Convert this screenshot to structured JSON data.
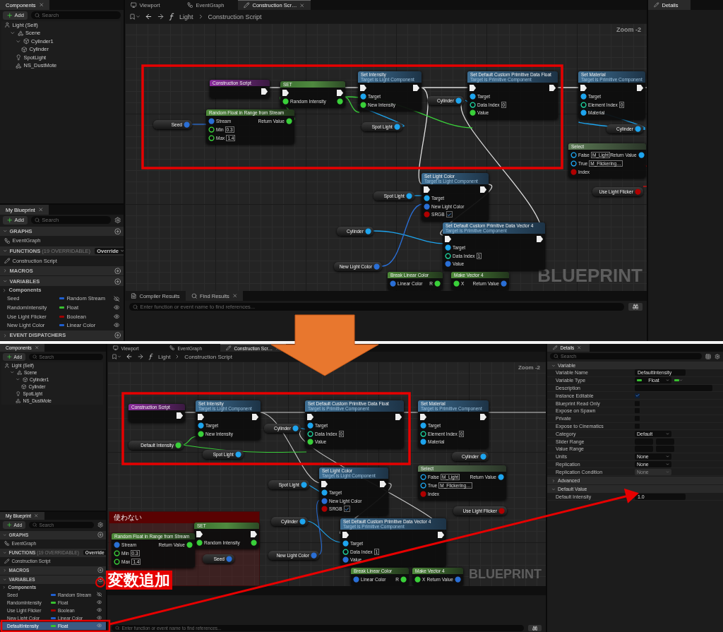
{
  "screens": [
    {
      "components": {
        "tab": "Components",
        "add": "Add",
        "search_placeholder": "Search",
        "tree": [
          {
            "label": "Light (Self)",
            "kind": "actor",
            "children": [
              {
                "label": "Scene",
                "kind": "scene",
                "expanded": true,
                "children": [
                  {
                    "label": "Cylinder1",
                    "kind": "mesh",
                    "expanded": true,
                    "children": [
                      {
                        "label": "Cylinder",
                        "kind": "mesh"
                      }
                    ]
                  },
                  {
                    "label": "SpotLight",
                    "kind": "light"
                  },
                  {
                    "label": "NS_DustMote",
                    "kind": "scene"
                  }
                ]
              }
            ]
          }
        ]
      },
      "my_blueprint": {
        "tab": "My Blueprint",
        "add": "Add",
        "search_placeholder": "Search",
        "sections": [
          {
            "title": "GRAPHS",
            "expanded": true,
            "items": [
              {
                "label": "EventGraph",
                "kind": "graph"
              }
            ]
          },
          {
            "title": "FUNCTIONS",
            "note": "(19 OVERRIDABLE)",
            "action": "Override",
            "expanded": true,
            "items": [
              {
                "label": "Construction Script",
                "kind": "function"
              }
            ]
          },
          {
            "title": "MACROS",
            "expanded": false
          },
          {
            "title": "VARIABLES",
            "expanded": true,
            "items": [
              {
                "label": "Components",
                "kind": "category"
              },
              {
                "label": "Seed",
                "kind": "variable",
                "type": "Random Stream",
                "color": "#1f5fd0",
                "visible": false,
                "selected": false
              },
              {
                "label": "RandomIntensity",
                "kind": "variable",
                "type": "Float",
                "color": "#38c030",
                "visible": true,
                "selected": false
              },
              {
                "label": "Use Light Flicker",
                "kind": "variable",
                "type": "Boolean",
                "color": "#a00000",
                "visible": true,
                "selected": false
              },
              {
                "label": "New Light Color",
                "kind": "variable",
                "type": "Linear Color",
                "color": "#1f5fd0",
                "visible": true,
                "selected": false
              }
            ]
          },
          {
            "title": "EVENT DISPATCHERS",
            "expanded": false
          }
        ]
      },
      "graph_tabs": [
        {
          "label": "Viewport",
          "kind": "viewport",
          "selected": false
        },
        {
          "label": "EventGraph",
          "kind": "graph",
          "selected": false
        },
        {
          "label": "Construction Scr…",
          "kind": "function",
          "selected": true
        }
      ],
      "breadcrumb": [
        "Light",
        "Construction Script"
      ],
      "zoom": "Zoom -2",
      "watermark": "BLUEPRINT",
      "nodes": [
        {
          "kind": "event",
          "title": "Construction Script",
          "outputs": [
            {
              "kind": "exec"
            }
          ]
        },
        {
          "kind": "setter",
          "title": "SET",
          "inputs": [
            {
              "kind": "exec"
            },
            {
              "kind": "float",
              "label": "Random Intensity"
            }
          ],
          "outputs": [
            {
              "kind": "exec"
            },
            {
              "kind": "float"
            }
          ]
        },
        {
          "kind": "variable",
          "title": "Seed",
          "outputs": [
            {
              "kind": "struct"
            }
          ]
        },
        {
          "kind": "pure",
          "title": "Random Float in Range from Stream",
          "inputs": [
            {
              "kind": "struct",
              "label": "Stream"
            },
            {
              "kind": "float",
              "label": "Min",
              "value": "0.3"
            },
            {
              "kind": "float",
              "label": "Max",
              "value": "1.4"
            }
          ],
          "outputs": [
            {
              "kind": "float",
              "label": "Return Value"
            }
          ]
        },
        {
          "kind": "function",
          "title": "Set Intensity",
          "subtitle": "Target is Light Component",
          "inputs": [
            {
              "kind": "exec"
            },
            {
              "kind": "object",
              "label": "Target"
            },
            {
              "kind": "float",
              "label": "New Intensity"
            }
          ],
          "outputs": [
            {
              "kind": "exec"
            }
          ]
        },
        {
          "kind": "variable",
          "title": "Spot Light",
          "outputs": [
            {
              "kind": "object"
            }
          ]
        },
        {
          "kind": "variable",
          "title": "Cylinder",
          "outputs": [
            {
              "kind": "object"
            }
          ]
        },
        {
          "kind": "function",
          "title": "Set Default Custom Primitive Data Float",
          "subtitle": "Target is Primitive Component",
          "inputs": [
            {
              "kind": "exec"
            },
            {
              "kind": "object",
              "label": "Target"
            },
            {
              "kind": "int",
              "label": "Data Index",
              "value": "0"
            },
            {
              "kind": "float",
              "label": "Value"
            }
          ],
          "outputs": [
            {
              "kind": "exec"
            }
          ]
        },
        {
          "kind": "function",
          "title": "Set Material",
          "subtitle": "Target is Primitive Component",
          "inputs": [
            {
              "kind": "exec"
            },
            {
              "kind": "object",
              "label": "Target"
            },
            {
              "kind": "int",
              "label": "Element Index",
              "value": "0"
            },
            {
              "kind": "object",
              "label": "Material"
            }
          ],
          "outputs": [
            {
              "kind": "exec"
            }
          ]
        },
        {
          "kind": "variable",
          "title": "Cylinder",
          "outputs": [
            {
              "kind": "object"
            }
          ]
        },
        {
          "kind": "select",
          "title": "Select",
          "inputs": [
            {
              "kind": "object",
              "label": "False",
              "value": "M_Light"
            },
            {
              "kind": "object",
              "label": "True",
              "value": "M_Flickering…"
            },
            {
              "kind": "bool",
              "label": "Index"
            }
          ],
          "outputs": [
            {
              "kind": "object",
              "label": "Return Value"
            }
          ]
        },
        {
          "kind": "variable",
          "title": "Use Light Flicker",
          "outputs": [
            {
              "kind": "bool"
            }
          ]
        },
        {
          "kind": "variable",
          "title": "Spot Light",
          "outputs": [
            {
              "kind": "object"
            }
          ]
        },
        {
          "kind": "function",
          "title": "Set Light Color",
          "subtitle": "Target is Light Component",
          "inputs": [
            {
              "kind": "exec"
            },
            {
              "kind": "object",
              "label": "Target"
            },
            {
              "kind": "struct",
              "label": "New Light Color"
            },
            {
              "kind": "bool",
              "label": "SRGB",
              "checked": true
            }
          ],
          "outputs": [
            {
              "kind": "exec"
            }
          ]
        },
        {
          "kind": "variable",
          "title": "Cylinder",
          "outputs": [
            {
              "kind": "object"
            }
          ]
        },
        {
          "kind": "function",
          "title": "Set Default Custom Primitive Data Vector 4",
          "subtitle": "Target is Primitive Component",
          "inputs": [
            {
              "kind": "exec"
            },
            {
              "kind": "object",
              "label": "Target"
            },
            {
              "kind": "int",
              "label": "Data Index",
              "value": "1"
            },
            {
              "kind": "struct",
              "label": "Value"
            }
          ],
          "outputs": [
            {
              "kind": "exec"
            }
          ]
        },
        {
          "kind": "variable",
          "title": "New Light Color",
          "outputs": [
            {
              "kind": "struct"
            }
          ]
        },
        {
          "kind": "pure",
          "title": "Break Linear Color",
          "inputs": [
            {
              "kind": "struct",
              "label": "Linear Color"
            }
          ],
          "outputs": [
            {
              "kind": "float",
              "label": "R"
            }
          ]
        },
        {
          "kind": "pure",
          "title": "Make Vector 4",
          "inputs": [
            {
              "kind": "float",
              "label": "X"
            }
          ],
          "outputs": [
            {
              "kind": "struct",
              "label": "Return Value"
            }
          ]
        }
      ],
      "results": {
        "tabs": [
          {
            "label": "Compiler Results",
            "kind": "log",
            "selected": false
          },
          {
            "label": "Find Results",
            "kind": "search",
            "selected": true
          }
        ],
        "placeholder": "Enter function or event name to find references..."
      },
      "details": {
        "tab": "Details"
      }
    },
    {
      "components": {
        "tab": "Components",
        "add": "Add",
        "search_placeholder": "Search",
        "tree": [
          {
            "label": "Light (Self)",
            "kind": "actor",
            "children": [
              {
                "label": "Scene",
                "kind": "scene",
                "expanded": true,
                "children": [
                  {
                    "label": "Cylinder1",
                    "kind": "mesh",
                    "expanded": true,
                    "children": [
                      {
                        "label": "Cylinder",
                        "kind": "mesh"
                      }
                    ]
                  },
                  {
                    "label": "SpotLight",
                    "kind": "light"
                  },
                  {
                    "label": "NS_DustMote",
                    "kind": "scene"
                  }
                ]
              }
            ]
          }
        ]
      },
      "my_blueprint": {
        "tab": "My Blueprint",
        "add": "Add",
        "search_placeholder": "Search",
        "sections": [
          {
            "title": "GRAPHS",
            "expanded": true,
            "items": [
              {
                "label": "EventGraph",
                "kind": "graph"
              }
            ]
          },
          {
            "title": "FUNCTIONS",
            "note": "(19 OVERRIDABLE)",
            "action": "Override",
            "expanded": true,
            "items": [
              {
                "label": "Construction Script",
                "kind": "function"
              }
            ]
          },
          {
            "title": "MACROS",
            "expanded": false
          },
          {
            "title": "VARIABLES",
            "expanded": true,
            "items": [
              {
                "label": "Components",
                "kind": "category"
              },
              {
                "label": "Seed",
                "kind": "variable",
                "type": "Random Stream",
                "color": "#1f5fd0",
                "visible": false,
                "selected": false
              },
              {
                "label": "RandomIntensity",
                "kind": "variable",
                "type": "Float",
                "color": "#38c030",
                "visible": true,
                "selected": false
              },
              {
                "label": "Use Light Flicker",
                "kind": "variable",
                "type": "Boolean",
                "color": "#a00000",
                "visible": true,
                "selected": false
              },
              {
                "label": "New Light Color",
                "kind": "variable",
                "type": "Linear Color",
                "color": "#1f5fd0",
                "visible": true,
                "selected": false
              },
              {
                "label": "DefaultIntensity",
                "kind": "variable",
                "type": "Float",
                "color": "#38c030",
                "visible": true,
                "selected": true
              }
            ]
          }
        ]
      },
      "graph_tabs": [
        {
          "label": "Viewport",
          "kind": "viewport",
          "selected": false
        },
        {
          "label": "EventGraph",
          "kind": "graph",
          "selected": false
        },
        {
          "label": "Construction Scr…",
          "kind": "function",
          "selected": true
        }
      ],
      "breadcrumb": [
        "Light",
        "Construction Script"
      ],
      "zoom": "Zoom -2",
      "watermark": "BLUEPRINT",
      "nodes": [
        {
          "kind": "event",
          "title": "Construction Script",
          "outputs": [
            {
              "kind": "exec"
            }
          ]
        },
        {
          "kind": "function",
          "title": "Set Intensity",
          "subtitle": "Target is Light Component",
          "inputs": [
            {
              "kind": "exec"
            },
            {
              "kind": "object",
              "label": "Target"
            },
            {
              "kind": "float",
              "label": "New Intensity"
            }
          ],
          "outputs": [
            {
              "kind": "exec"
            }
          ]
        },
        {
          "kind": "variable",
          "title": "Default Intensity",
          "outputs": [
            {
              "kind": "float"
            }
          ]
        },
        {
          "kind": "variable",
          "title": "Spot Light",
          "outputs": [
            {
              "kind": "object"
            }
          ]
        },
        {
          "kind": "variable",
          "title": "Cylinder",
          "outputs": [
            {
              "kind": "object"
            }
          ]
        },
        {
          "kind": "function",
          "title": "Set Default Custom Primitive Data Float",
          "subtitle": "Target is Primitive Component",
          "inputs": [
            {
              "kind": "exec"
            },
            {
              "kind": "object",
              "label": "Target"
            },
            {
              "kind": "int",
              "label": "Data Index",
              "value": "0"
            },
            {
              "kind": "float",
              "label": "Value"
            }
          ],
          "outputs": [
            {
              "kind": "exec"
            }
          ]
        },
        {
          "kind": "function",
          "title": "Set Material",
          "subtitle": "Target is Primitive Component",
          "inputs": [
            {
              "kind": "exec"
            },
            {
              "kind": "object",
              "label": "Target"
            },
            {
              "kind": "int",
              "label": "Element Index",
              "value": "0"
            },
            {
              "kind": "object",
              "label": "Material"
            }
          ],
          "outputs": [
            {
              "kind": "exec"
            }
          ]
        },
        {
          "kind": "variable",
          "title": "Cylinder",
          "outputs": [
            {
              "kind": "object"
            }
          ]
        },
        {
          "kind": "select",
          "title": "Select",
          "inputs": [
            {
              "kind": "object",
              "label": "False",
              "value": "M_Light"
            },
            {
              "kind": "object",
              "label": "True",
              "value": "M_Flickering…"
            },
            {
              "kind": "bool",
              "label": "Index"
            }
          ],
          "outputs": [
            {
              "kind": "object",
              "label": "Return Value"
            }
          ]
        },
        {
          "kind": "variable",
          "title": "Use Light Flicker",
          "outputs": [
            {
              "kind": "bool"
            }
          ]
        },
        {
          "kind": "variable",
          "title": "Spot Light",
          "outputs": [
            {
              "kind": "object"
            }
          ]
        },
        {
          "kind": "function",
          "title": "Set Light Color",
          "subtitle": "Target is Light Component",
          "inputs": [
            {
              "kind": "exec"
            },
            {
              "kind": "object",
              "label": "Target"
            },
            {
              "kind": "struct",
              "label": "New Light Color"
            },
            {
              "kind": "bool",
              "label": "SRGB",
              "checked": true
            }
          ],
          "outputs": [
            {
              "kind": "exec"
            }
          ]
        },
        {
          "kind": "variable",
          "title": "Cylinder",
          "outputs": [
            {
              "kind": "object"
            }
          ]
        },
        {
          "kind": "function",
          "title": "Set Default Custom Primitive Data Vector 4",
          "subtitle": "Target is Primitive Component",
          "inputs": [
            {
              "kind": "exec"
            },
            {
              "kind": "object",
              "label": "Target"
            },
            {
              "kind": "int",
              "label": "Data Index",
              "value": "1"
            },
            {
              "kind": "struct",
              "label": "Value"
            }
          ],
          "outputs": [
            {
              "kind": "exec"
            }
          ]
        },
        {
          "kind": "variable",
          "title": "New Light Color",
          "outputs": [
            {
              "kind": "struct"
            }
          ]
        },
        {
          "kind": "pure",
          "title": "Break Linear Color",
          "inputs": [
            {
              "kind": "struct",
              "label": "Linear Color"
            }
          ],
          "outputs": [
            {
              "kind": "float",
              "label": "R"
            }
          ]
        },
        {
          "kind": "pure",
          "title": "Make Vector 4",
          "inputs": [
            {
              "kind": "float",
              "label": "X"
            }
          ],
          "outputs": [
            {
              "kind": "struct",
              "label": "Return Value"
            }
          ]
        }
      ],
      "comment": {
        "title": "使わない",
        "nodes": [
          {
            "kind": "setter",
            "title": "SET",
            "inputs": [
              {
                "kind": "exec"
              },
              {
                "kind": "float",
                "label": "Random Intensity"
              }
            ],
            "outputs": [
              {
                "kind": "exec"
              },
              {
                "kind": "float"
              }
            ]
          },
          {
            "kind": "pure",
            "title": "Random Float in Range from Stream",
            "inputs": [
              {
                "kind": "struct",
                "label": "Stream"
              },
              {
                "kind": "float",
                "label": "Min",
                "value": "0.3"
              },
              {
                "kind": "float",
                "label": "Max",
                "value": "1.4"
              }
            ],
            "outputs": [
              {
                "kind": "float",
                "label": "Return Value"
              }
            ]
          },
          {
            "kind": "variable",
            "title": "Seed",
            "outputs": [
              {
                "kind": "struct"
              }
            ]
          }
        ]
      },
      "results": {
        "placeholder": "Enter function or event name to find references..."
      },
      "details": {
        "tab": "Details",
        "search_placeholder": "Search",
        "sections": [
          {
            "title": "Variable",
            "expanded": true,
            "rows": [
              {
                "label": "Variable Name",
                "kind": "text",
                "value": "DefaultIntensity"
              },
              {
                "label": "Variable Type",
                "kind": "type",
                "value": "Float"
              },
              {
                "label": "Description",
                "kind": "wide"
              },
              {
                "label": "Instance Editable",
                "kind": "check",
                "checked": true
              },
              {
                "label": "Blueprint Read Only",
                "kind": "check",
                "checked": false
              },
              {
                "label": "Expose on Spawn",
                "kind": "check",
                "checked": false
              },
              {
                "label": "Private",
                "kind": "check",
                "checked": false
              },
              {
                "label": "Expose to Cinematics",
                "kind": "check",
                "checked": false
              },
              {
                "label": "Category",
                "kind": "select",
                "value": "Default",
                "disabled": false
              },
              {
                "label": "Slider Range",
                "kind": "range"
              },
              {
                "label": "Value Range",
                "kind": "range"
              },
              {
                "label": "Units",
                "kind": "select",
                "value": "None",
                "disabled": false
              },
              {
                "label": "Replication",
                "kind": "select",
                "value": "None",
                "disabled": false
              },
              {
                "label": "Replication Condition",
                "kind": "select",
                "value": "None",
                "disabled": true
              }
            ]
          },
          {
            "title": "Advanced",
            "expanded": false
          },
          {
            "title": "Default Value",
            "expanded": true,
            "rows": [
              {
                "label": "Default Intensity",
                "kind": "text",
                "value": "1.0"
              }
            ]
          }
        ]
      }
    }
  ],
  "callout": "変数追加"
}
